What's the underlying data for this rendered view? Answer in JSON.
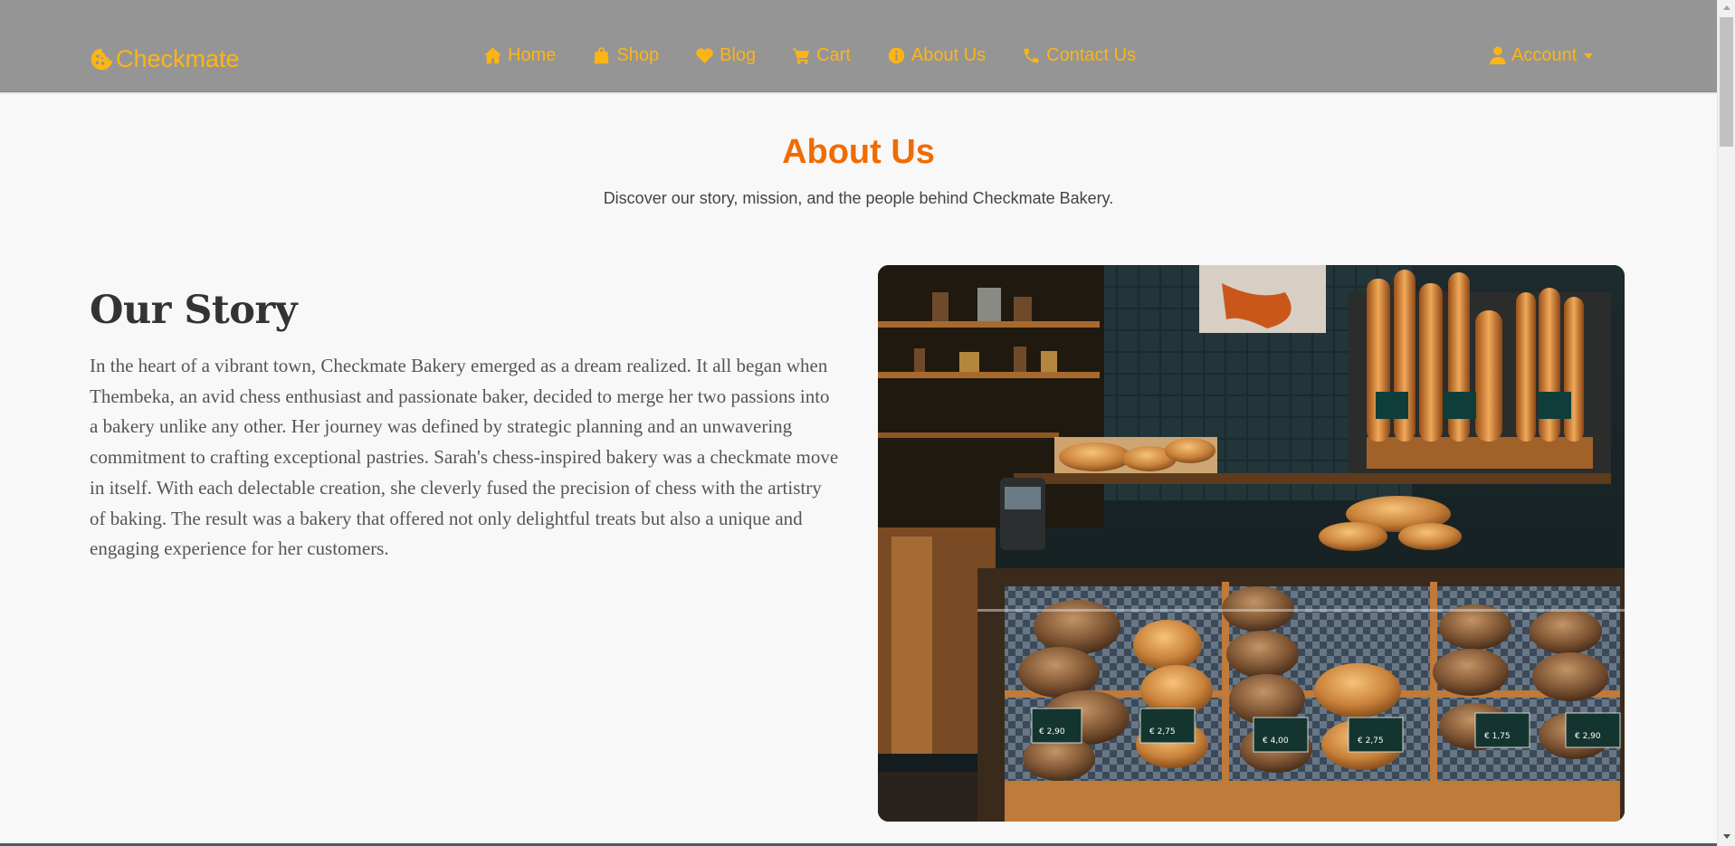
{
  "brand": {
    "name": "Checkmate",
    "color": "#fdb515",
    "icon": "cookie-icon"
  },
  "nav": [
    {
      "label": "Home",
      "icon": "home-icon"
    },
    {
      "label": "Shop",
      "icon": "shopping-bag-icon"
    },
    {
      "label": "Blog",
      "icon": "heart-icon"
    },
    {
      "label": "Cart",
      "icon": "cart-icon"
    },
    {
      "label": "About Us",
      "icon": "info-circle-icon"
    },
    {
      "label": "Contact Us",
      "icon": "phone-icon"
    }
  ],
  "account": {
    "label": "Account",
    "icon": "user-icon"
  },
  "header": {
    "title": "About Us",
    "title_color": "#ef6c00",
    "subtitle": "Discover our story, mission, and the people behind Checkmate Bakery."
  },
  "story": {
    "heading": "Our Story",
    "body": "In the heart of a vibrant town, Checkmate Bakery emerged as a dream realized. It all began when Thembeka, an avid chess enthusiast and passionate baker, decided to merge her two passions into a bakery unlike any other. Her journey was defined by strategic planning and an unwavering commitment to crafting exceptional pastries. Sarah's chess-inspired bakery was a checkmate move in itself. With each delectable creation, she cleverly fused the precision of chess with the artistry of baking. The result was a bakery that offered not only delightful treats but also a unique and engaging experience for her customers."
  },
  "image": {
    "subject": "bakery display case with breads and baguettes"
  },
  "price_tags": [
    "€ 2,75",
    "€ 4,00",
    "€ 2,75",
    "€ 1,75",
    "€ 2,90",
    "€ 2,90"
  ]
}
